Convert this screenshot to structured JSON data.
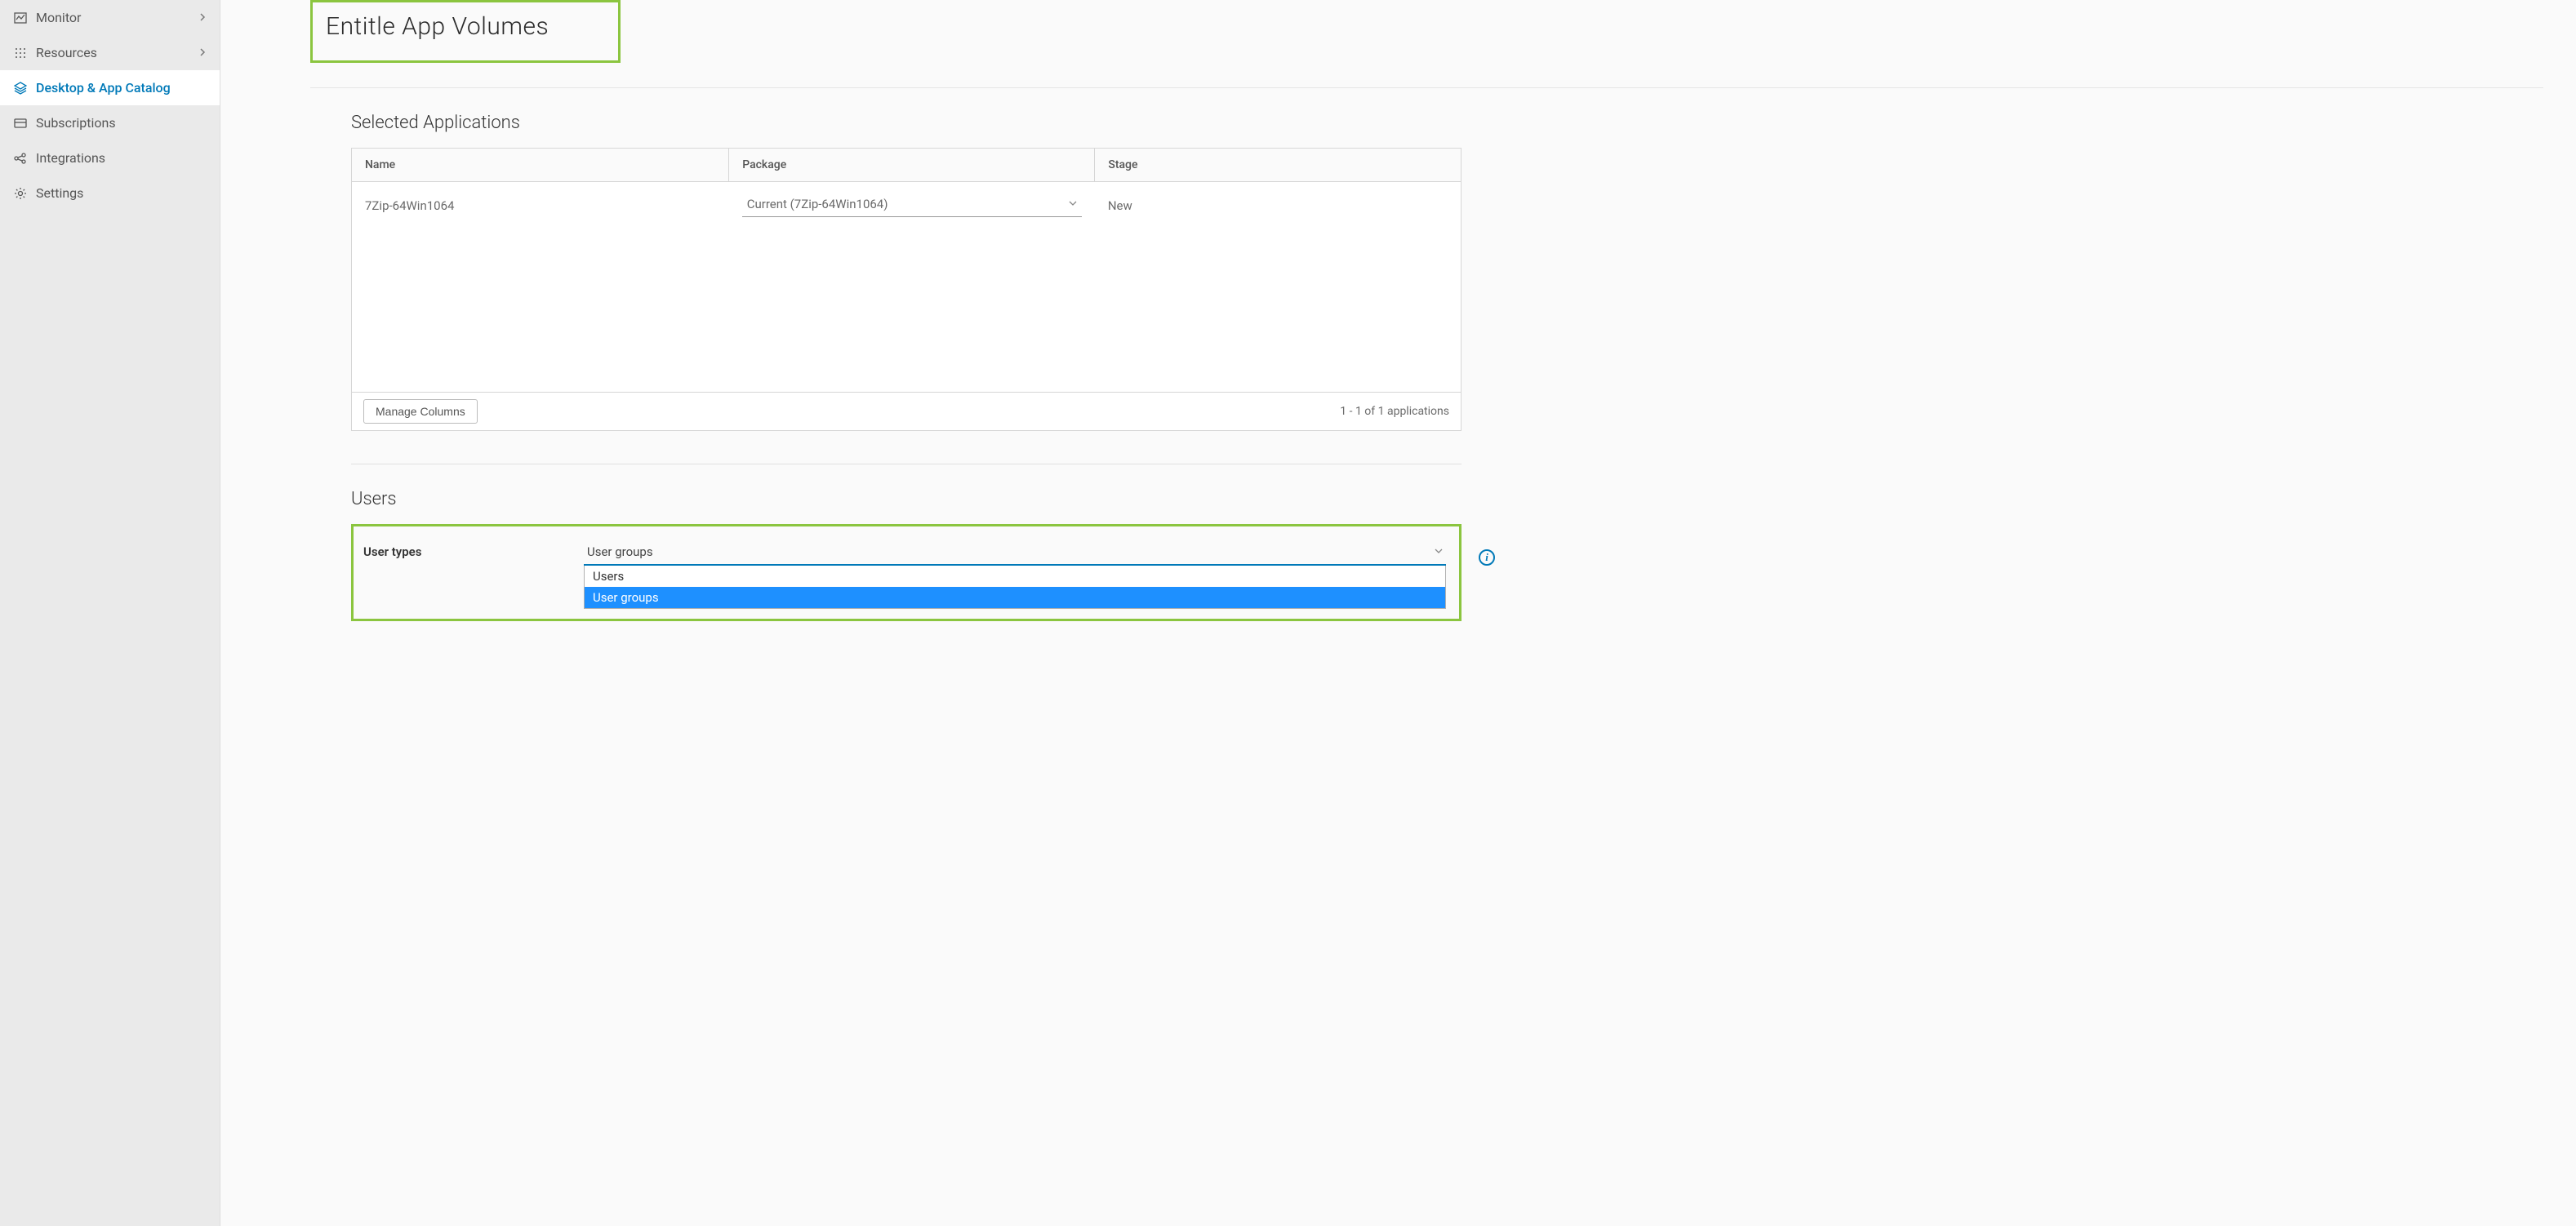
{
  "sidebar": {
    "items": [
      {
        "id": "monitor",
        "label": "Monitor",
        "expandable": true
      },
      {
        "id": "resources",
        "label": "Resources",
        "expandable": true
      },
      {
        "id": "desktop-app-catalog",
        "label": "Desktop & App Catalog",
        "expandable": false,
        "active": true
      },
      {
        "id": "subscriptions",
        "label": "Subscriptions",
        "expandable": false
      },
      {
        "id": "integrations",
        "label": "Integrations",
        "expandable": false
      },
      {
        "id": "settings",
        "label": "Settings",
        "expandable": false
      }
    ]
  },
  "page": {
    "title": "Entitle App Volumes"
  },
  "selected_apps": {
    "heading": "Selected Applications",
    "columns": {
      "name": "Name",
      "package": "Package",
      "stage": "Stage"
    },
    "rows": [
      {
        "name": "7Zip-64Win1064",
        "package": "Current (7Zip-64Win1064)",
        "stage": "New"
      }
    ],
    "manage_columns_label": "Manage Columns",
    "footer_count": "1 - 1 of 1 applications"
  },
  "users": {
    "heading": "Users",
    "user_types_label": "User types",
    "selected": "User groups",
    "options": [
      "Users",
      "User groups"
    ]
  }
}
